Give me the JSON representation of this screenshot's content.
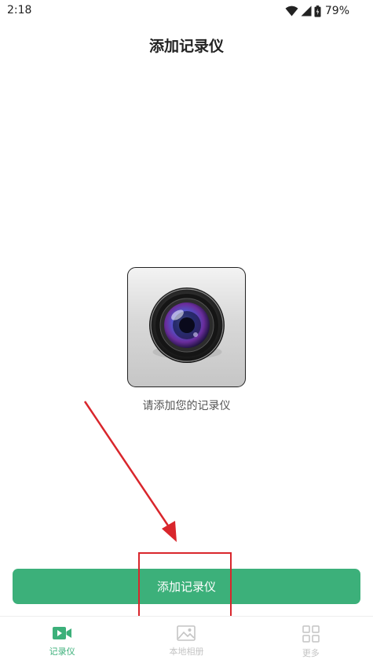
{
  "status_bar": {
    "time": "2:18",
    "battery": "79%",
    "icons": [
      "wifi-icon",
      "cell-signal-icon",
      "battery-icon"
    ]
  },
  "header": {
    "title": "添加记录仪"
  },
  "main": {
    "device_image": "camera-lens-icon",
    "hint": "请添加您的记录仪",
    "add_button_label": "添加记录仪"
  },
  "tabs": [
    {
      "label": "记录仪",
      "icon": "video-camera-icon",
      "active": true
    },
    {
      "label": "本地相册",
      "icon": "image-icon",
      "active": false
    },
    {
      "label": "更多",
      "icon": "grid-icon",
      "active": false
    }
  ],
  "colors": {
    "accent": "#3cb07a",
    "annotation": "#d9262c",
    "inactive": "#c4c4c4"
  }
}
